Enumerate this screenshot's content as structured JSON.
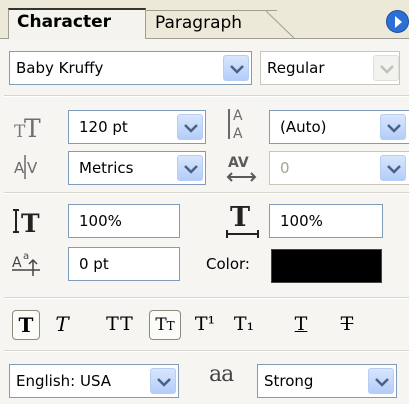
{
  "tabs": [
    {
      "label": "Character",
      "active": true
    },
    {
      "label": "Paragraph",
      "active": false
    }
  ],
  "font": {
    "family": "Baby Kruffy",
    "style": "Regular"
  },
  "size": {
    "value": "120 pt",
    "icon": "font-size-icon"
  },
  "leading": {
    "value": "(Auto)",
    "icon": "leading-icon"
  },
  "kerning": {
    "value": "Metrics",
    "icon": "kerning-icon"
  },
  "tracking": {
    "value": "0",
    "icon": "tracking-icon",
    "disabled": true
  },
  "vertical_scale": {
    "value": "100%",
    "icon": "vertical-scale-icon"
  },
  "horizontal_scale": {
    "value": "100%",
    "icon": "horizontal-scale-icon"
  },
  "baseline_shift": {
    "value": "0 pt",
    "icon": "baseline-shift-icon"
  },
  "color": {
    "label": "Color:",
    "value": "#000000"
  },
  "type_styles": [
    {
      "glyph": "T",
      "name": "faux-bold-button",
      "active": true
    },
    {
      "glyph": "T",
      "name": "faux-italic-button",
      "active": false
    },
    {
      "glyph": "TT",
      "name": "all-caps-button",
      "active": false
    },
    {
      "glyph": "Tt",
      "name": "small-caps-button",
      "active": true
    },
    {
      "glyph": "T¹",
      "name": "superscript-button",
      "active": false
    },
    {
      "glyph": "T₁",
      "name": "subscript-button",
      "active": false
    },
    {
      "glyph": "T",
      "name": "underline-button",
      "active": false
    },
    {
      "glyph": "T",
      "name": "strikethrough-button",
      "active": false
    }
  ],
  "language": {
    "value": "English: USA"
  },
  "antialias": {
    "icon_text": "aa",
    "value": "Strong",
    "icon": "antialias-icon"
  },
  "colors": {
    "field_border": "#7f9db9",
    "dropdown_button": "#c5d9fb",
    "panel_menu": "#2e6fd6"
  }
}
